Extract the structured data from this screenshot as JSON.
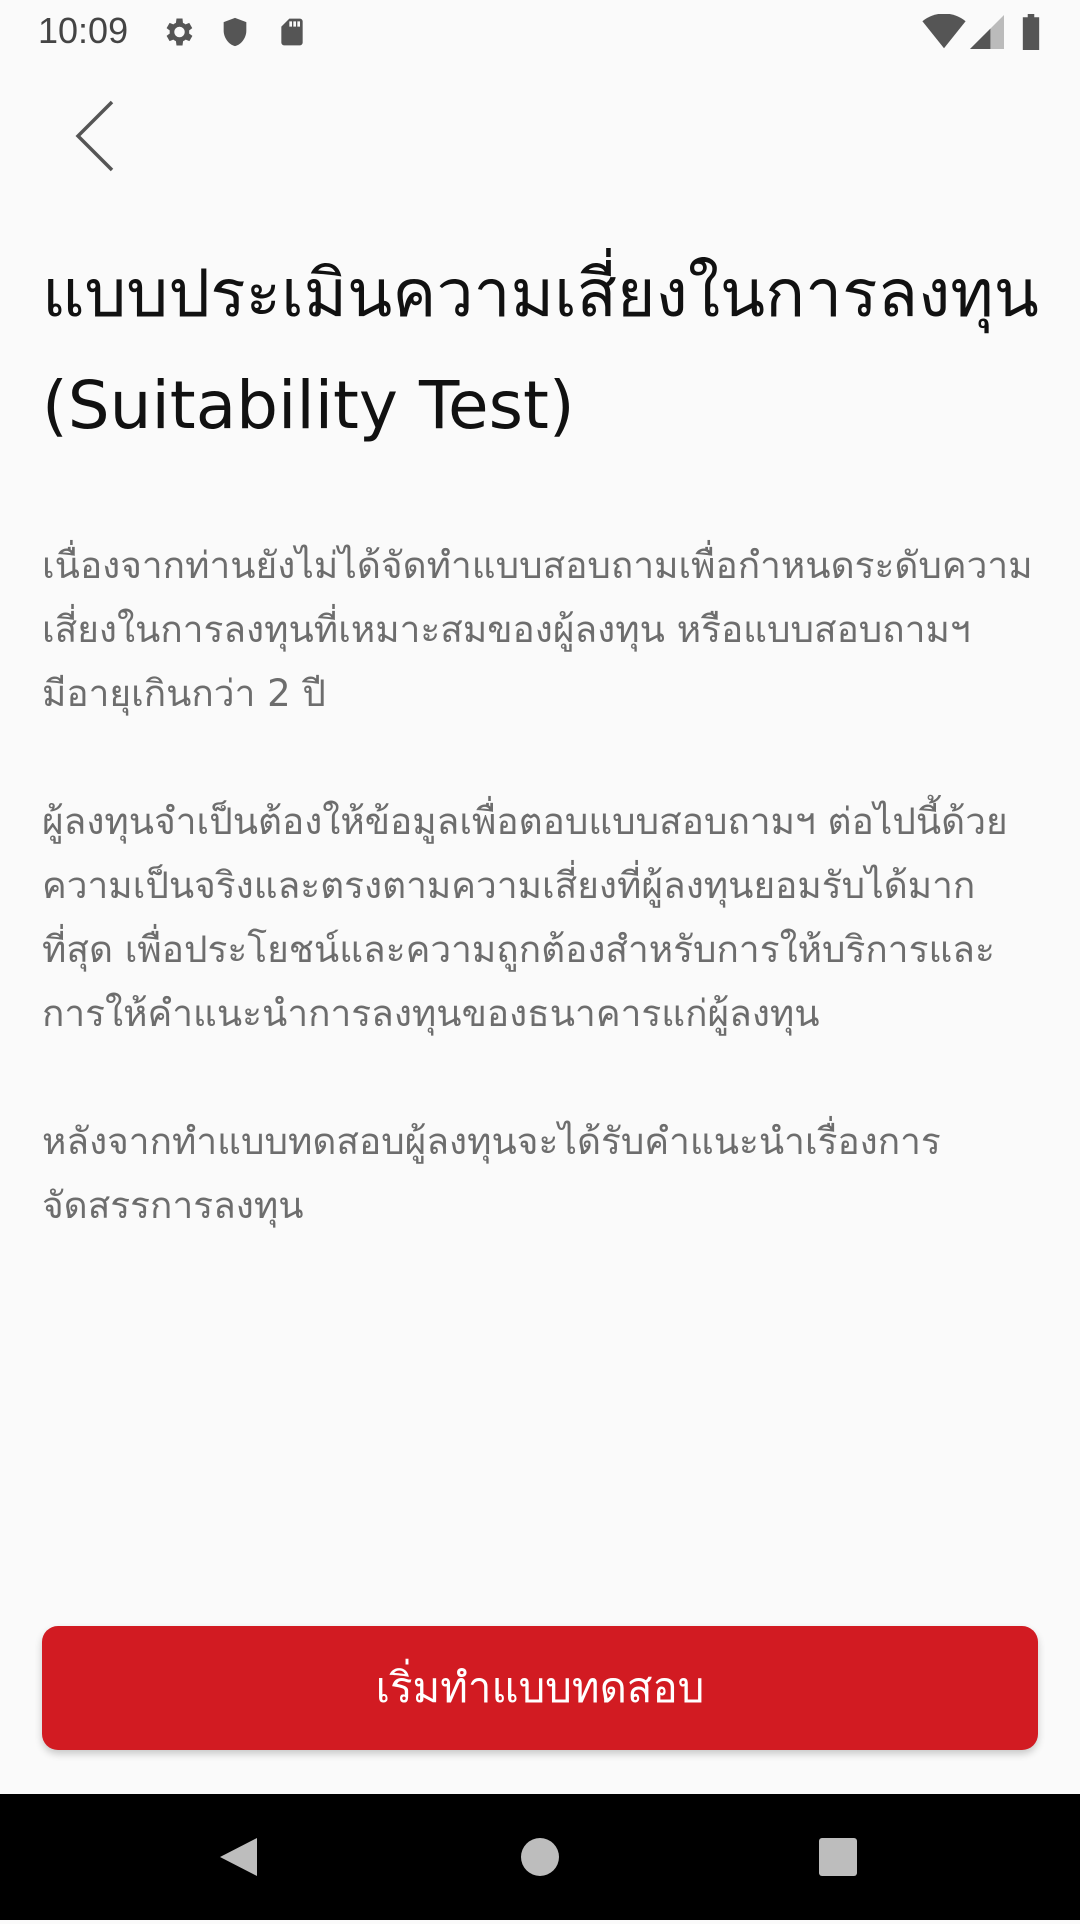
{
  "status_bar": {
    "time": "10:09",
    "icons": [
      "gear-icon",
      "shield-icon",
      "sd-card-icon",
      "wifi-icon",
      "signal-icon",
      "battery-icon"
    ]
  },
  "header": {
    "back_icon": "chevron-left-icon"
  },
  "main": {
    "title": "แบบประเมินความเสี่ยงในการลงทุน (Suitability Test)",
    "paragraphs": [
      "เนื่องจากท่านยังไม่ได้จัดทำแบบสอบถามเพื่อกำหนดระดับความเสี่ยงในการลงทุนที่เหมาะสมของผู้ลงทุน หรือแบบสอบถามฯ มีอายุเกินกว่า 2 ปี",
      "ผู้ลงทุนจำเป็นต้องให้ข้อมูลเพื่อตอบแบบสอบถามฯ ต่อไปนี้ด้วยความเป็นจริงและตรงตามความเสี่ยงที่ผู้ลงทุนยอมรับได้มากที่สุด เพื่อประโยชน์และความถูกต้องสำหรับการให้บริการและการให้คำแนะนำการลงทุนของธนาคารแก่ผู้ลงทุน",
      "หลังจากทำแบบทดสอบผู้ลงทุนจะได้รับคำแนะนำเรื่องการจัดสรรการลงทุน"
    ]
  },
  "footer": {
    "start_button_label": "เริ่มทำแบบทดสอบ"
  },
  "colors": {
    "accent": "#d21b22",
    "background": "#fafafa",
    "body_text": "#6d6d6d",
    "title_text": "#111111"
  },
  "navigation_bar": {
    "buttons": [
      "back-triangle-icon",
      "home-circle-icon",
      "recents-square-icon"
    ]
  }
}
